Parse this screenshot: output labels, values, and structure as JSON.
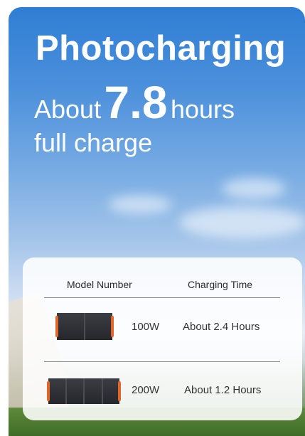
{
  "hero": {
    "title": "Photocharging",
    "line1_prefix": "About",
    "line1_number": "7.8",
    "line1_suffix": "hours",
    "line2": "full charge"
  },
  "table": {
    "headers": {
      "model": "Model Number",
      "time": "Charging Time"
    },
    "rows": [
      {
        "model": "100W",
        "time": "About 2.4 Hours",
        "panel_segments": 2
      },
      {
        "model": "200W",
        "time": "About 1.2 Hours",
        "panel_segments": 4
      }
    ]
  },
  "colors": {
    "accent": "#e2662a",
    "panel": "#2b2d31"
  }
}
